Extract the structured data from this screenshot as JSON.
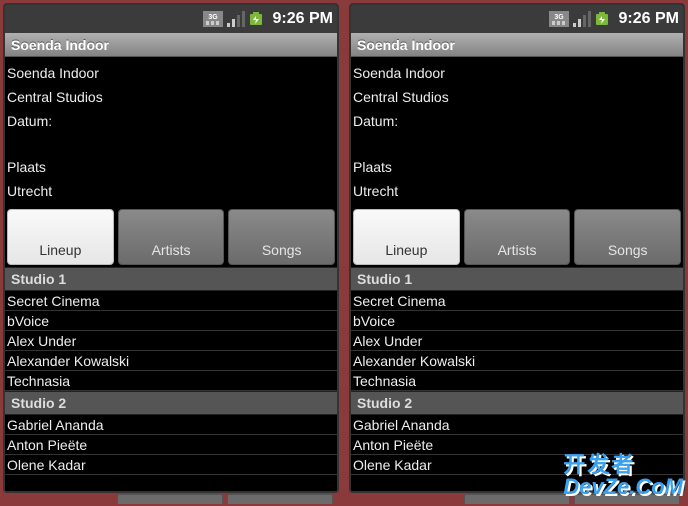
{
  "status": {
    "clock": "9:26 PM"
  },
  "titleBar": "Soenda Indoor",
  "info": {
    "name": "Soenda Indoor",
    "venue": "Central Studios",
    "dateLabel": "Datum:",
    "placeLabel": "Plaats",
    "city": "Utrecht"
  },
  "tabs": {
    "lineup": "Lineup",
    "artists": "Artists",
    "songs": "Songs"
  },
  "sections": [
    {
      "name": "Studio 1",
      "rows": [
        "Secret Cinema",
        "bVoice",
        "Alex Under",
        "Alexander Kowalski",
        "Technasia"
      ]
    },
    {
      "name": "Studio 2",
      "rows": [
        "Gabriel Ananda",
        "Anton Pieëte",
        "Olene Kadar"
      ]
    }
  ],
  "watermark": {
    "cn": "开发者",
    "en": "DevZe.CoM"
  }
}
